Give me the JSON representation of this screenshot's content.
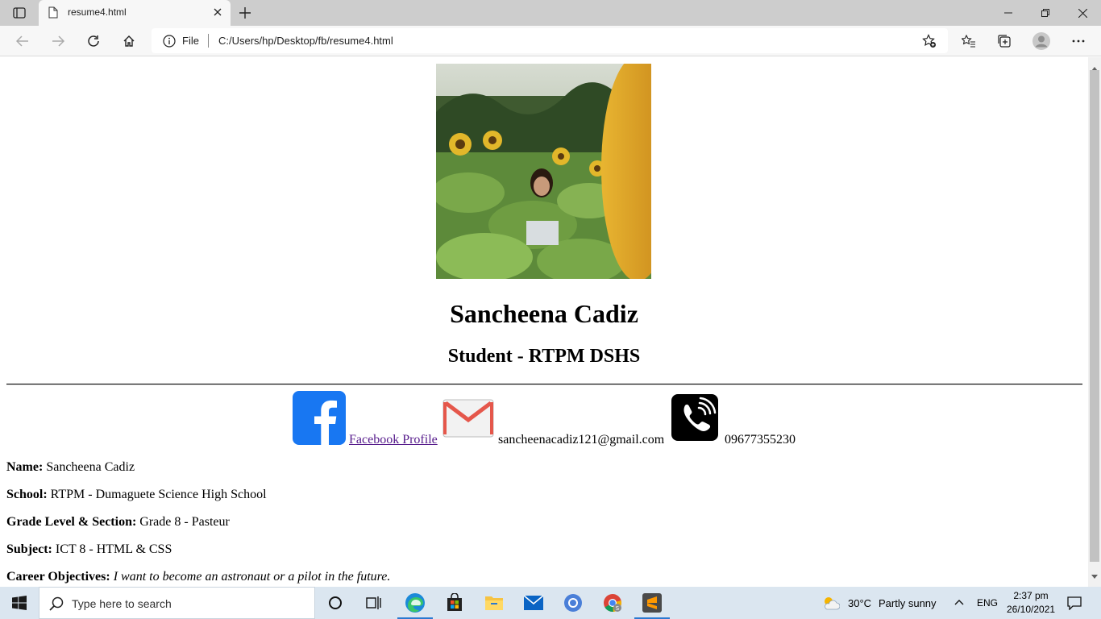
{
  "browser": {
    "tab_title": "resume4.html",
    "address_scheme": "File",
    "address_url": "C:/Users/hp/Desktop/fb/resume4.html"
  },
  "resume": {
    "name": "Sancheena Cadiz",
    "role": "Student - RTPM DSHS",
    "contacts": {
      "facebook_label": "Facebook Profile",
      "email": "sancheenacadiz121@gmail.com",
      "phone": "09677355230"
    },
    "details": [
      {
        "label": "Name:",
        "value": "Sancheena Cadiz"
      },
      {
        "label": "School:",
        "value": "RTPM - Dumaguete Science High School"
      },
      {
        "label": "Grade Level & Section:",
        "value": "Grade 8 - Pasteur"
      },
      {
        "label": "Subject:",
        "value": "ICT 8 - HTML & CSS"
      },
      {
        "label": "Career Objectives:",
        "value": "I want to become an astronaut or a pilot in the future."
      }
    ]
  },
  "taskbar": {
    "search_placeholder": "Type here to search",
    "temperature": "30°C",
    "weather": "Partly sunny",
    "language": "ENG",
    "time": "2:37 pm",
    "date": "26/10/2021"
  },
  "colors": {
    "link_visited": "#551a8b",
    "facebook_blue": "#1877f2",
    "taskbar": "#dbe6f0"
  }
}
